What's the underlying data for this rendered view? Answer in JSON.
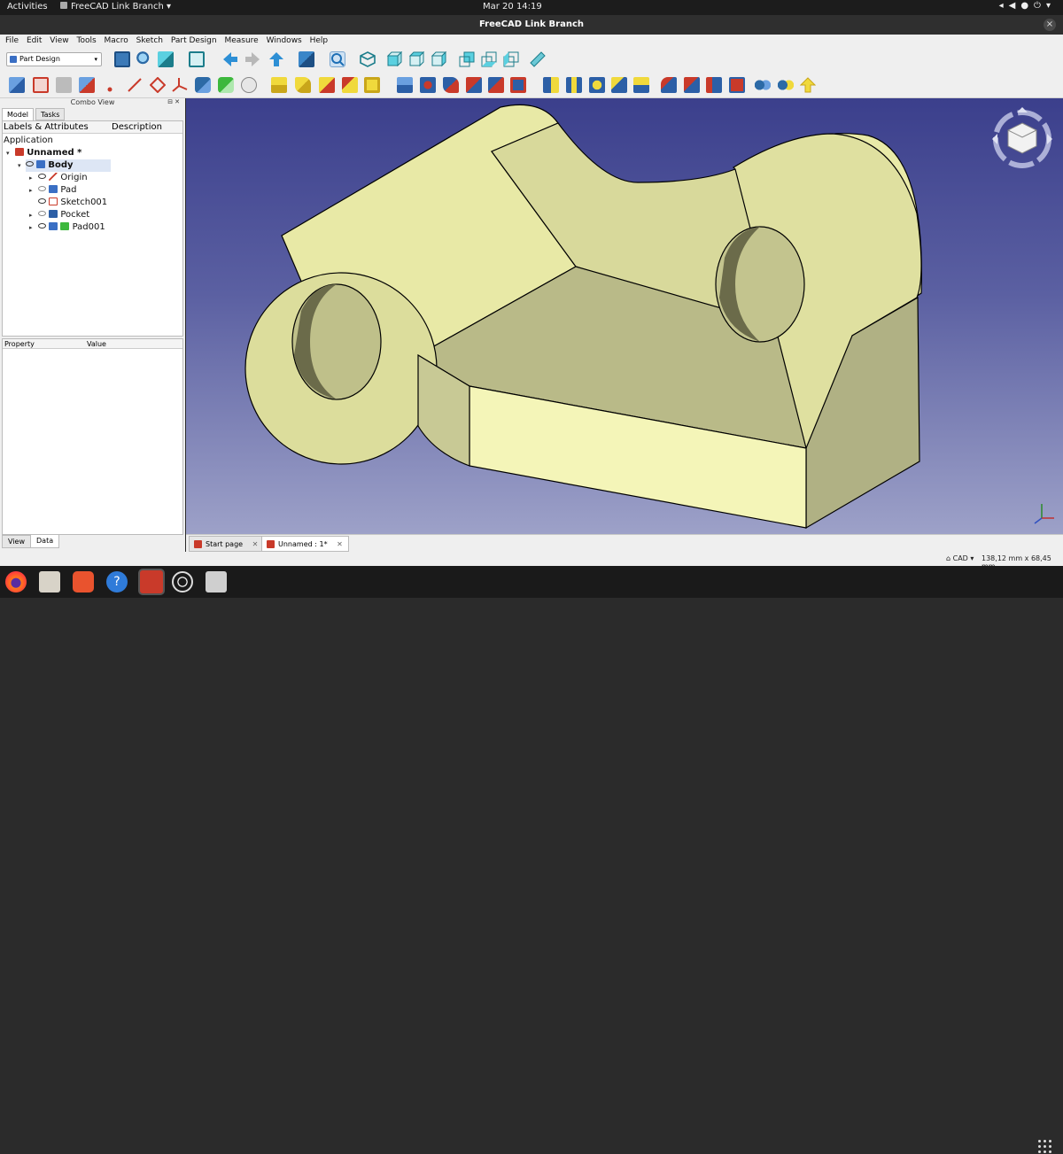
{
  "topbar": {
    "activities": "Activities",
    "app_name": "FreeCAD Link Branch",
    "clock": "Mar 20  14:19",
    "app_menu_arrow": "▾"
  },
  "window": {
    "title": "FreeCAD Link Branch",
    "close": "×"
  },
  "menu": [
    "File",
    "Edit",
    "View",
    "Tools",
    "Macro",
    "Sketch",
    "Part Design",
    "Measure",
    "Windows",
    "Help"
  ],
  "workbench": {
    "selected": "Part Design"
  },
  "combo_view": {
    "title": "Combo View",
    "tabs": [
      "Model",
      "Tasks"
    ]
  },
  "tree": {
    "columns": [
      "Labels & Attributes",
      "Description"
    ],
    "root": "Application",
    "document": "Unnamed *",
    "body": "Body",
    "items": [
      "Origin",
      "Pad",
      "Sketch001",
      "Pocket",
      "Pad001"
    ]
  },
  "properties": {
    "columns": [
      "Property",
      "Value"
    ],
    "tabs": [
      "View",
      "Data"
    ]
  },
  "doc_tabs": [
    {
      "label": "Start page",
      "close": "✕"
    },
    {
      "label": "Unnamed : 1*",
      "close": "✕"
    }
  ],
  "status": {
    "nav_style": "CAD",
    "dimensions": "138,12 mm x 68,45 mm"
  },
  "colors": {
    "part_face": "#f4f5b8",
    "part_side": "#dcdca0",
    "part_shade": "#a9a97c",
    "viewport_top": "#3b3f8c",
    "viewport_bottom": "#9da1c8",
    "accent": "#3a6fc4"
  },
  "dock": [
    "firefox-icon",
    "files-icon",
    "software-center-icon",
    "help-icon",
    "freecad-icon",
    "obs-icon",
    "screenshot-icon"
  ]
}
